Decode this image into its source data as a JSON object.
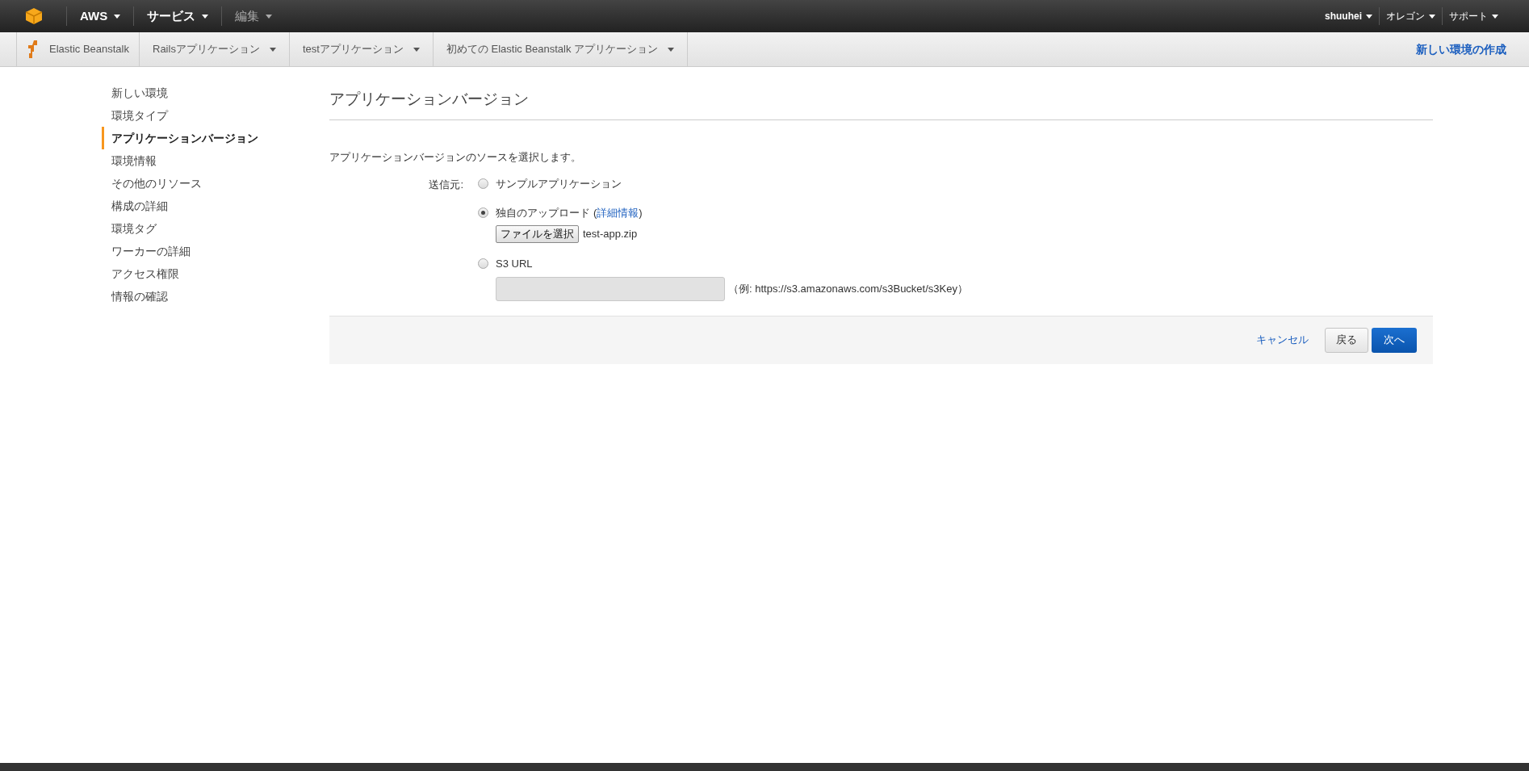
{
  "top_nav": {
    "items": [
      {
        "label": "AWS",
        "kind": "bold"
      },
      {
        "label": "サービス",
        "kind": "bold"
      },
      {
        "label": "編集",
        "kind": "muted"
      }
    ],
    "right_items": [
      {
        "label": "shuuhei",
        "kind": "bold"
      },
      {
        "label": "オレゴン",
        "kind": "normal"
      },
      {
        "label": "サポート",
        "kind": "normal"
      }
    ]
  },
  "breadcrumb": {
    "service": "Elastic Beanstalk",
    "items": [
      {
        "label": "Railsアプリケーション"
      },
      {
        "label": "testアプリケーション"
      },
      {
        "label": "初めての Elastic Beanstalk アプリケーション"
      }
    ],
    "action": "新しい環境の作成"
  },
  "sidebar": {
    "items": [
      {
        "label": "新しい環境",
        "selected": false
      },
      {
        "label": "環境タイプ",
        "selected": false
      },
      {
        "label": "アプリケーションバージョン",
        "selected": true
      },
      {
        "label": "環境情報",
        "selected": false
      },
      {
        "label": "その他のリソース",
        "selected": false
      },
      {
        "label": "構成の詳細",
        "selected": false
      },
      {
        "label": "環境タグ",
        "selected": false
      },
      {
        "label": "ワーカーの詳細",
        "selected": false
      },
      {
        "label": "アクセス権限",
        "selected": false
      },
      {
        "label": "情報の確認",
        "selected": false
      }
    ]
  },
  "form": {
    "title": "アプリケーションバージョン",
    "description": "アプリケーションバージョンのソースを選択します。",
    "source_label": "送信元:",
    "options": [
      {
        "kind": "plain",
        "label": "サンプルアプリケーション",
        "selected": false
      },
      {
        "kind": "upload",
        "label": "独自のアップロード",
        "link_open": "(",
        "link": "詳細情報",
        "link_close": ")",
        "button": "ファイルを選択",
        "file_name": "test-app.zip",
        "selected": true
      },
      {
        "kind": "url",
        "label": "S3 URL",
        "hint": "（例: https://s3.amazonaws.com/s3Bucket/s3Key）",
        "selected": false
      }
    ]
  },
  "footer": {
    "cancel": "キャンセル",
    "back": "戻る",
    "next": "次へ"
  }
}
